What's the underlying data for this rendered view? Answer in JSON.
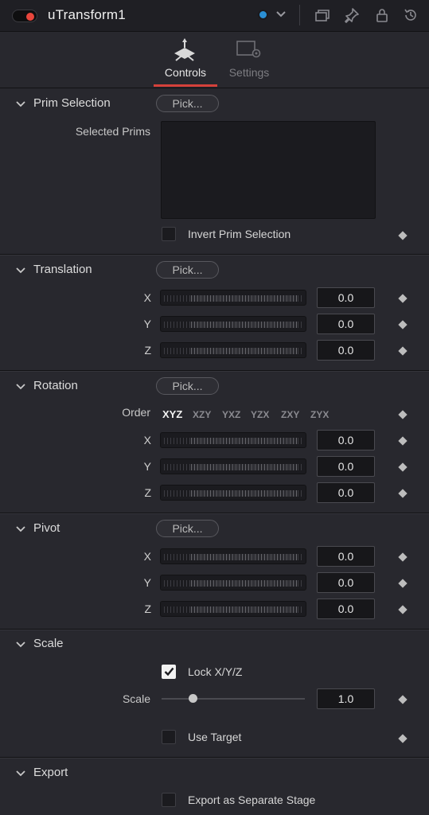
{
  "header": {
    "title": "uTransform1",
    "accent_color": "#e8463c",
    "node_color": "#2a8fd4",
    "icons": [
      "dropdown-chevron-icon",
      "versions-icon",
      "pin-icon",
      "lock-icon",
      "reset-icon"
    ]
  },
  "tabs": [
    {
      "label": "Controls",
      "active": true,
      "icon": "transform-axes-icon"
    },
    {
      "label": "Settings",
      "active": false,
      "icon": "settings-gear-icon"
    }
  ],
  "pick_label": "Pick...",
  "prim_selection": {
    "title": "Prim Selection",
    "selected_prims_label": "Selected Prims",
    "selected_prims_value": "",
    "invert_label": "Invert Prim Selection",
    "invert_checked": false
  },
  "translation": {
    "title": "Translation",
    "x_label": "X",
    "x_value": "0.0",
    "y_label": "Y",
    "y_value": "0.0",
    "z_label": "Z",
    "z_value": "0.0"
  },
  "rotation": {
    "title": "Rotation",
    "order_label": "Order",
    "order_options": [
      "XYZ",
      "XZY",
      "YXZ",
      "YZX",
      "ZXY",
      "ZYX"
    ],
    "order_selected": "XYZ",
    "x_label": "X",
    "x_value": "0.0",
    "y_label": "Y",
    "y_value": "0.0",
    "z_label": "Z",
    "z_value": "0.0"
  },
  "pivot": {
    "title": "Pivot",
    "x_label": "X",
    "x_value": "0.0",
    "y_label": "Y",
    "y_value": "0.0",
    "z_label": "Z",
    "z_value": "0.0"
  },
  "scale": {
    "title": "Scale",
    "lock_label": "Lock X/Y/Z",
    "lock_checked": true,
    "scale_label": "Scale",
    "scale_value": "1.0",
    "use_target_label": "Use Target",
    "use_target_checked": false
  },
  "export": {
    "title": "Export",
    "separate_stage_label": "Export as Separate Stage",
    "separate_stage_checked": false
  }
}
